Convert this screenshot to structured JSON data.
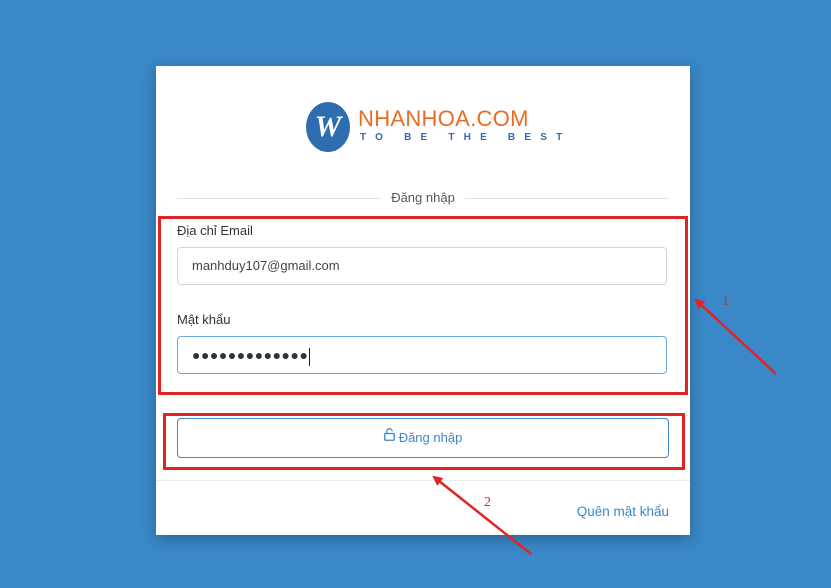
{
  "logo": {
    "mark": "W",
    "brand": "NHANHOA.COM",
    "tagline": "TO BE THE BEST"
  },
  "form": {
    "section_title": "Đăng nhập",
    "email_label": "Địa chỉ Email",
    "email_value": "manhduy107@gmail.com",
    "password_label": "Mật khẩu",
    "password_masked": "●●●●●●●●●●●●●",
    "submit_label": "Đăng nhập",
    "submit_icon": "unlock-icon",
    "forgot_link": "Quên mật khẩu"
  },
  "annotations": {
    "label_1": "1",
    "label_2": "2",
    "color": "#e32222"
  },
  "colors": {
    "background": "#3a88c8",
    "brand_orange": "#e86c24",
    "brand_blue": "#2e6db0",
    "accent": "#3a88c8"
  }
}
